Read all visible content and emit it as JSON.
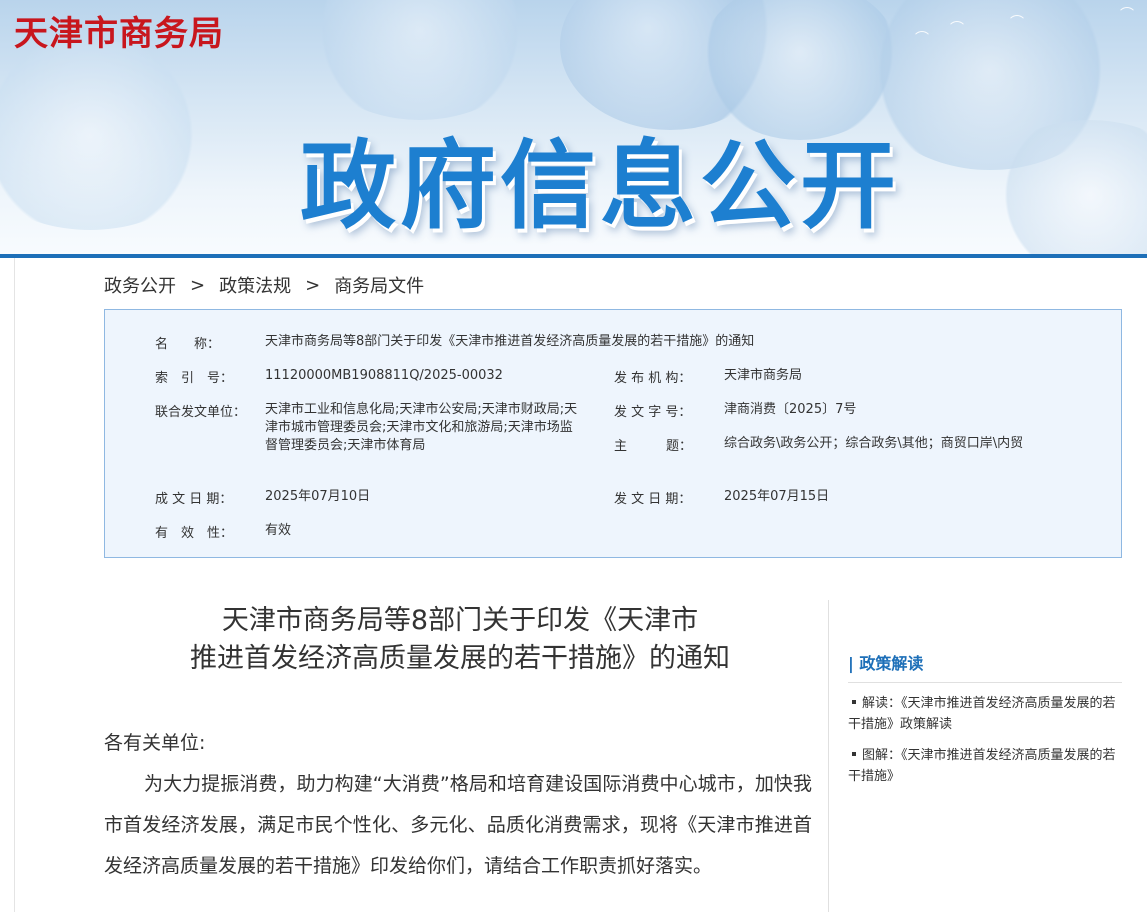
{
  "header": {
    "site_name": "天津市商务局",
    "banner_title": "政府信息公开"
  },
  "breadcrumb": {
    "items": [
      "政务公开",
      "政策法规",
      "商务局文件"
    ],
    "separator": ">"
  },
  "info": {
    "name_label": "名　　称：",
    "name_value": "天津市商务局等8部门关于印发《天津市推进首发经济高质量发展的若干措施》的通知",
    "index_label": "索　引　号：",
    "index_value": "11120000MB1908811Q/2025-00032",
    "publisher_label": "发 布 机 构：",
    "publisher_value": "天津市商务局",
    "joint_label": "联合发文单位：",
    "joint_value": "天津市工业和信息化局;天津市公安局;天津市财政局;天津市城市管理委员会;天津市文化和旅游局;天津市场监督管理委员会;天津市体育局",
    "docno_label": "发 文 字 号：",
    "docno_value": "津商消费〔2025〕7号",
    "topic_label": "主　　　题：",
    "topic_value": "综合政务\\政务公开；综合政务\\其他；商贸口岸\\内贸",
    "created_label": "成 文 日 期：",
    "created_value": "2025年07月10日",
    "issued_label": "发 文 日 期：",
    "issued_value": "2025年07月15日",
    "validity_label": "有　效　性：",
    "validity_value": "有效"
  },
  "article": {
    "title_line1": "天津市商务局等8部门关于印发《天津市",
    "title_line2": "推进首发经济高质量发展的若干措施》的通知",
    "salutation": "各有关单位:",
    "paragraph": "为大力提振消费，助力构建“大消费”格局和培育建设国际消费中心城市，加快我市首发经济发展，满足市民个性化、多元化、品质化消费需求，现将《天津市推进首发经济高质量发展的若干措施》印发给你们，请结合工作职责抓好落实。"
  },
  "sidebar": {
    "heading": "| 政策解读",
    "items": [
      "解读：《天津市推进首发经济高质量发展的若干措施》政策解读",
      "图解：《天津市推进首发经济高质量发展的若干措施》"
    ]
  },
  "colors": {
    "brand_red": "#c8161d",
    "banner_blue": "#1d7fd0",
    "accent_blue": "#1d6fb8",
    "infobox_bg": "#eef5fd",
    "infobox_border": "#8fb8e2"
  }
}
